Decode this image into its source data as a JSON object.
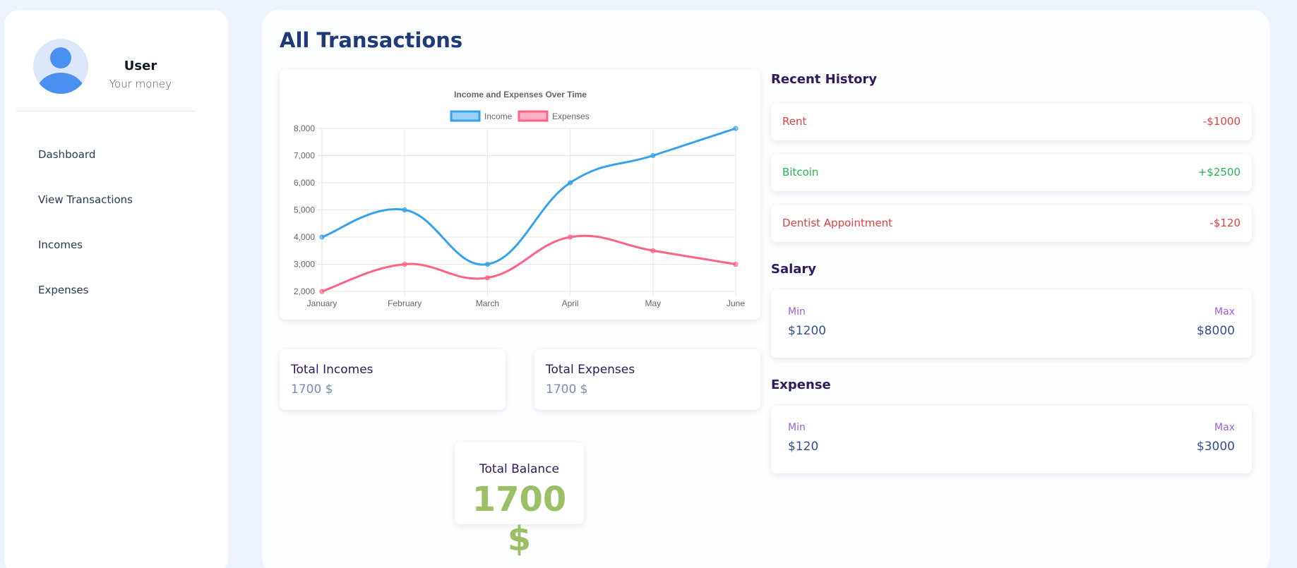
{
  "profile": {
    "name": "User",
    "subtitle": "Your money"
  },
  "nav": {
    "items": [
      {
        "label": "Dashboard"
      },
      {
        "label": "View Transactions"
      },
      {
        "label": "Incomes"
      },
      {
        "label": "Expenses"
      }
    ]
  },
  "page": {
    "title": "All Transactions"
  },
  "chart_data": {
    "type": "line",
    "title": "Income and Expenses Over Time",
    "categories": [
      "January",
      "February",
      "March",
      "April",
      "May",
      "June"
    ],
    "series": [
      {
        "name": "Income",
        "values": [
          4000,
          5000,
          3000,
          6000,
          7000,
          8000
        ],
        "color": "#36a2eb"
      },
      {
        "name": "Expenses",
        "values": [
          2000,
          3000,
          2500,
          4000,
          3500,
          3000
        ],
        "color": "#ff6384"
      }
    ],
    "ylim": [
      2000,
      8000
    ],
    "yticks": [
      "8,000",
      "7,000",
      "6,000",
      "5,000",
      "4,000",
      "3,000",
      "2,000"
    ],
    "grid": true,
    "legend": "top"
  },
  "totals": {
    "incomes_label": "Total Incomes",
    "incomes_value": "1700 $",
    "expenses_label": "Total Expenses",
    "expenses_value": "1700 $",
    "balance_label": "Total Balance",
    "balance_value": "1700 $"
  },
  "history": {
    "title": "Recent History",
    "items": [
      {
        "name": "Rent",
        "amount": "-$1000"
      },
      {
        "name": "Bitcoin",
        "amount": "+$2500"
      },
      {
        "name": "Dentist Appointment",
        "amount": "-$120"
      }
    ]
  },
  "salary": {
    "title": "Salary",
    "min_label": "Min",
    "max_label": "Max",
    "min": "$1200",
    "max": "$8000"
  },
  "expense": {
    "title": "Expense",
    "min_label": "Min",
    "max_label": "Max",
    "min": "$120",
    "max": "$3000"
  },
  "colors": {
    "accent": "#1e3a7b",
    "income": "#36a2eb",
    "expenses": "#ff6384",
    "balance": "#9bbf64",
    "negative": "#e53e3e",
    "positive": "#22b550"
  }
}
